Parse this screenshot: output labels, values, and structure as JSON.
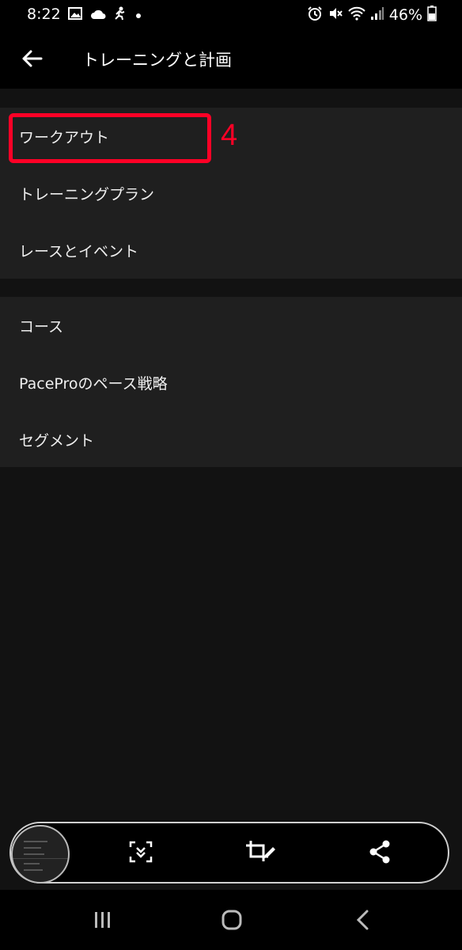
{
  "status_bar": {
    "time": "8:22",
    "battery_percent": "46%",
    "left_icons": [
      "image-icon",
      "cloud-icon",
      "runner-icon",
      "dot-icon"
    ],
    "right_icons": [
      "alarm-icon",
      "mute-icon",
      "wifi-icon",
      "signal-icon",
      "battery-icon"
    ]
  },
  "app_bar": {
    "title": "トレーニングと計画",
    "back_icon": "back-arrow-icon"
  },
  "groups": [
    {
      "items": [
        "ワークアウト",
        "トレーニングプラン",
        "レースとイベント"
      ]
    },
    {
      "items": [
        "コース",
        "PaceProのペース戦略",
        "セグメント"
      ]
    }
  ],
  "annotation": {
    "number": "4",
    "color": "#ff0026"
  },
  "screenshot_toolbar": {
    "icons": [
      "scroll-capture-icon",
      "crop-edit-icon",
      "share-icon"
    ]
  },
  "nav_bar": {
    "icons": [
      "recent-apps-icon",
      "home-icon",
      "back-icon"
    ]
  }
}
